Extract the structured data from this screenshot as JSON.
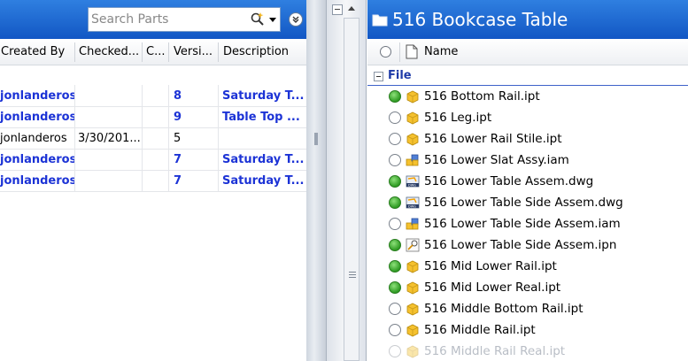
{
  "left_pane": {
    "search": {
      "placeholder": "Search Parts"
    },
    "columns": [
      "Created By",
      "Checked...",
      "C...",
      "Versi...",
      "Description"
    ],
    "rows": [
      {
        "created_by": "jonlanderos",
        "checked": "",
        "c": "",
        "version": "8",
        "description": "Saturday T...",
        "bold": true
      },
      {
        "created_by": "jonlanderos",
        "checked": "",
        "c": "",
        "version": "9",
        "description": "Table Top ...",
        "bold": true
      },
      {
        "created_by": "jonlanderos",
        "checked": "3/30/201...",
        "c": "",
        "version": "5",
        "description": "",
        "bold": false
      },
      {
        "created_by": "jonlanderos",
        "checked": "",
        "c": "",
        "version": "7",
        "description": "Saturday T...",
        "bold": true
      },
      {
        "created_by": "jonlanderos",
        "checked": "",
        "c": "",
        "version": "7",
        "description": "Saturday T...",
        "bold": true
      }
    ]
  },
  "right_pane": {
    "title": "516 Bookcase Table",
    "name_header": "Name",
    "group_label": "File",
    "files": [
      {
        "name": "516 Bottom Rail.ipt",
        "status": "green",
        "icon": "part-icon"
      },
      {
        "name": "516 Leg.ipt",
        "status": "empty",
        "icon": "part-icon"
      },
      {
        "name": "516 Lower Rail Stile.ipt",
        "status": "empty",
        "icon": "part-icon"
      },
      {
        "name": "516 Lower Slat Assy.iam",
        "status": "empty",
        "icon": "assembly-icon"
      },
      {
        "name": "516 Lower Table Assem.dwg",
        "status": "green",
        "icon": "drawing-icon"
      },
      {
        "name": "516 Lower Table Side Assem.dwg",
        "status": "green",
        "icon": "drawing-icon"
      },
      {
        "name": "516 Lower Table Side Assem.iam",
        "status": "empty",
        "icon": "assembly-icon"
      },
      {
        "name": "516 Lower Table Side Assem.ipn",
        "status": "green",
        "icon": "presentation-icon"
      },
      {
        "name": "516 Mid Lower Rail.ipt",
        "status": "green",
        "icon": "part-icon"
      },
      {
        "name": "516 Mid Lower Real.ipt",
        "status": "green",
        "icon": "part-icon"
      },
      {
        "name": "516 Middle Bottom Rail.ipt",
        "status": "empty",
        "icon": "part-icon"
      },
      {
        "name": "516 Middle Rail.ipt",
        "status": "empty",
        "icon": "part-icon"
      },
      {
        "name": "516 Middle Rail Real.ipt",
        "status": "empty",
        "icon": "part-icon",
        "faded": true
      }
    ]
  },
  "colors": {
    "header_blue": "#1e6ad8",
    "bold_text": "#1c33d6",
    "status_green": "#3fae2f"
  }
}
